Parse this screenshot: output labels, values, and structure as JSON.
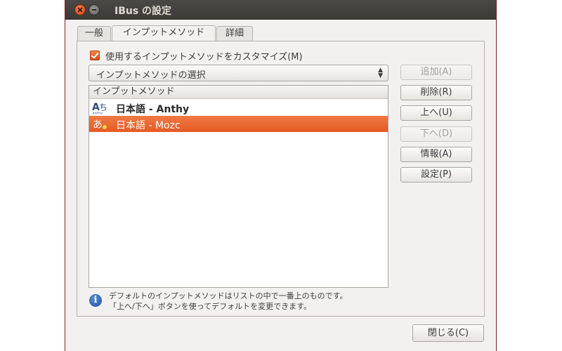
{
  "window": {
    "title": "IBus の設定"
  },
  "tabs": [
    {
      "label": "一般"
    },
    {
      "label": "インプットメソッド"
    },
    {
      "label": "詳細"
    }
  ],
  "active_tab": "インプットメソッド",
  "customize": {
    "label": "使用するインプットメソッドをカスタマイズ(M)",
    "checked": true
  },
  "combo": {
    "value": "インプットメソッドの選択"
  },
  "list": {
    "header": "インプットメソッド",
    "items": [
      {
        "label": "日本語 - Anthy",
        "icon": "anthy-icon",
        "selected": false
      },
      {
        "label": "日本語 - Mozc",
        "icon": "mozc-icon",
        "selected": true
      }
    ]
  },
  "buttons": {
    "add": "追加(A)",
    "remove": "削除(R)",
    "up": "上へ(U)",
    "down": "下へ(D)",
    "info": "情報(A)",
    "settings": "設定(P)",
    "close": "閉じる(C)"
  },
  "disabled_buttons": [
    "add",
    "down"
  ],
  "hint": {
    "line1": "デフォルトのインプットメソッドはリストの中で一番上のものです。",
    "line2": "「上へ/下へ」ボタンを使ってデフォルトを変更できます。"
  },
  "colors": {
    "accent": "#e65a23",
    "titlebar": "#3c3b37",
    "window_bg": "#f2f1f0"
  }
}
